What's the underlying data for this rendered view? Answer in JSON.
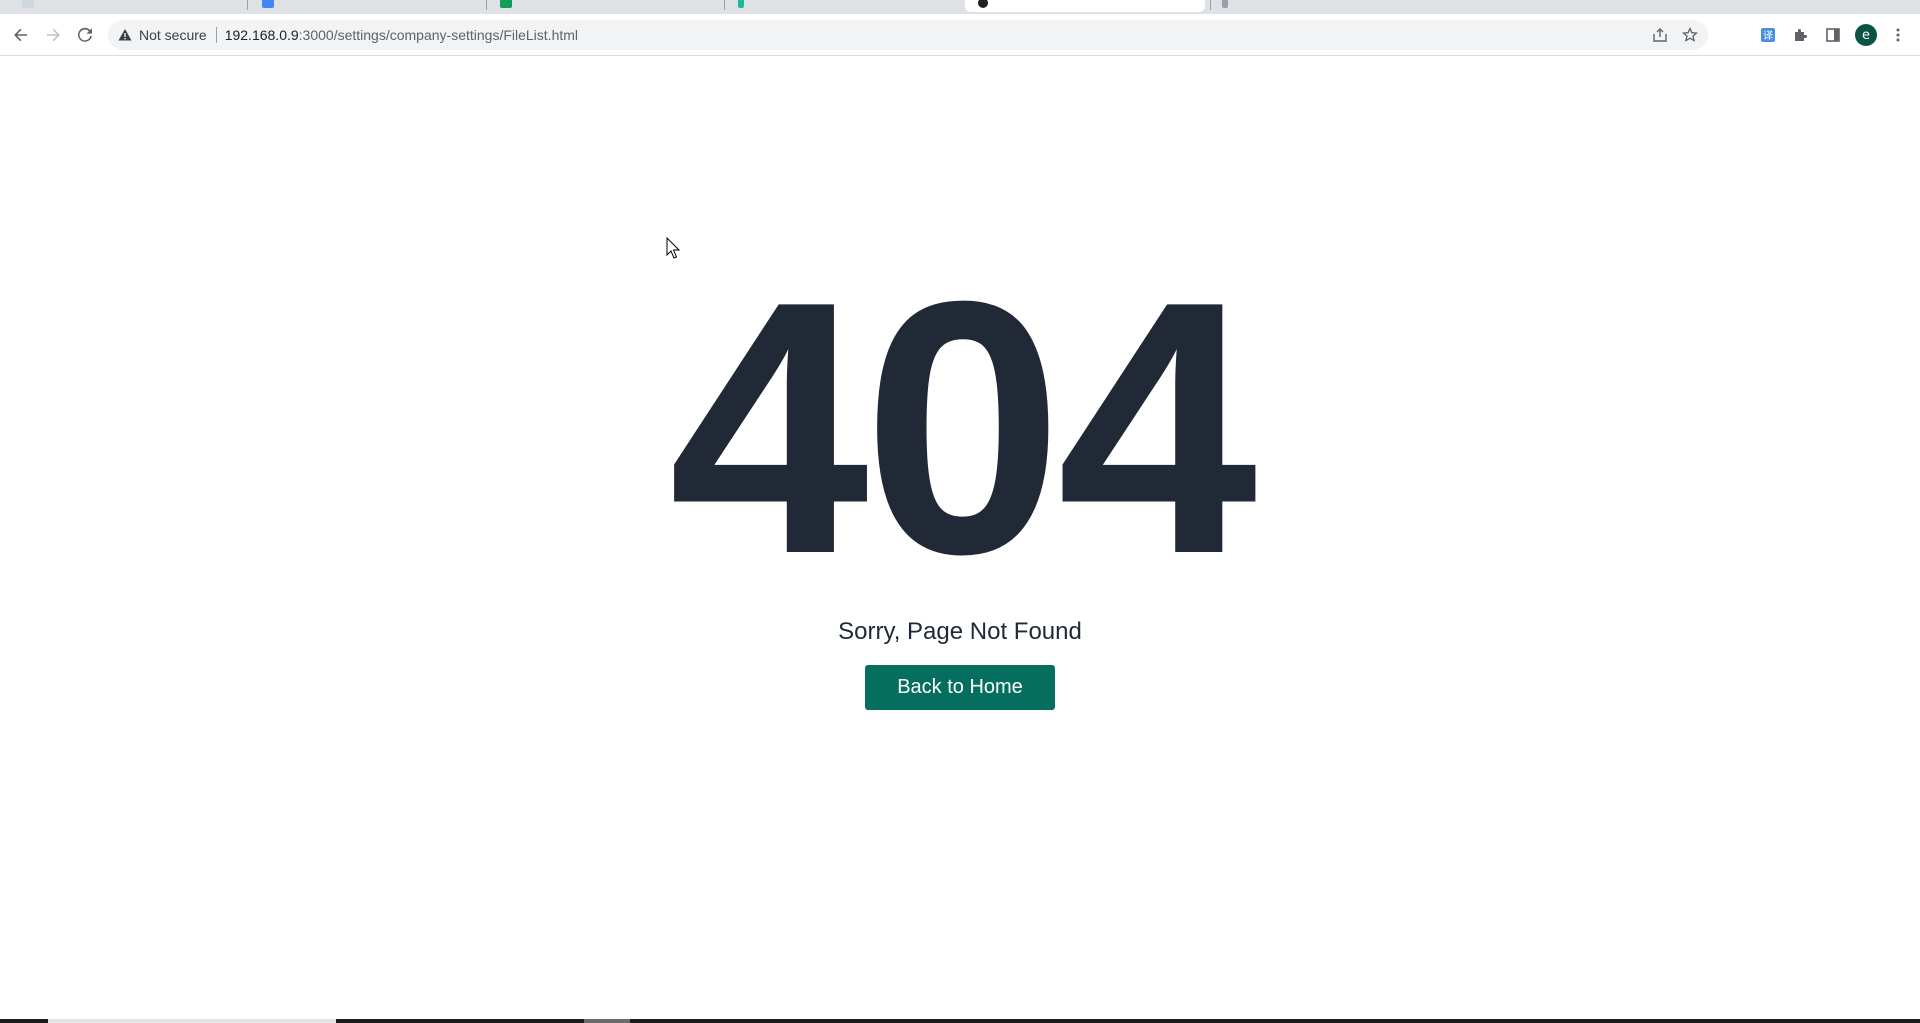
{
  "browser": {
    "back_icon": "arrow-left-icon",
    "forward_icon": "arrow-right-icon",
    "reload_icon": "reload-icon",
    "security_label": "Not secure",
    "url_host": "192.168.0.9",
    "url_rest": ":3000/settings/company-settings/FileList.html",
    "profile_initial": "e",
    "profile_color": "#0b5345"
  },
  "page": {
    "error_code": "404",
    "message": "Sorry, Page Not Found",
    "back_button_label": "Back to Home",
    "accent_color": "#066e5f",
    "text_color": "#212936"
  }
}
